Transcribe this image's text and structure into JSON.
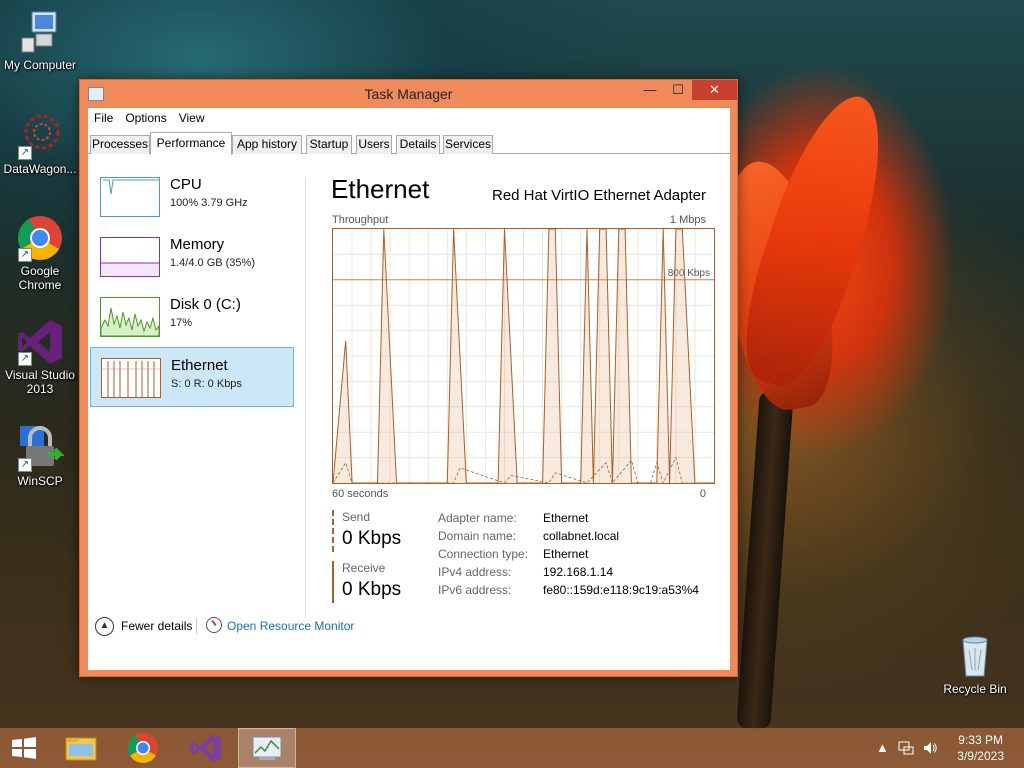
{
  "desktop": {
    "icons": [
      {
        "label": "My Computer",
        "icon": "computer-icon"
      },
      {
        "label": "DataWagon...",
        "icon": "datawagon-icon"
      },
      {
        "label": "Google Chrome",
        "icon": "chrome-icon"
      },
      {
        "label": "Visual Studio 2013",
        "icon": "visual-studio-icon"
      },
      {
        "label": "WinSCP",
        "icon": "winscp-icon"
      },
      {
        "label": "Recycle Bin",
        "icon": "recycle-bin-icon"
      }
    ]
  },
  "window": {
    "title": "Task Manager",
    "controls": {
      "minimize": "—",
      "maximize": "☐",
      "close": "✕"
    },
    "accent_color": "#f08a5a"
  },
  "menu": [
    "File",
    "Options",
    "View"
  ],
  "tabs": [
    "Processes",
    "Performance",
    "App history",
    "Startup",
    "Users",
    "Details",
    "Services"
  ],
  "active_tab": "Performance",
  "nav": [
    {
      "title": "CPU",
      "sub": "100%  3.79 GHz",
      "color": "#4a9ccb"
    },
    {
      "title": "Memory",
      "sub": "1.4/4.0 GB (35%)",
      "color": "#8b2fa8"
    },
    {
      "title": "Disk 0 (C:)",
      "sub": "17%",
      "color": "#4d9a1e"
    },
    {
      "title": "Ethernet",
      "sub": "S: 0 R: 0 Kbps",
      "color": "#a7602a",
      "selected": true
    }
  ],
  "ethernet": {
    "title": "Ethernet",
    "adapter": "Red Hat VirtIO Ethernet Adapter",
    "throughput_label": "Throughput",
    "max_label": "1 Mbps",
    "ref_label": "800 Kbps",
    "xaxis_left": "60 seconds",
    "xaxis_right": "0",
    "send_label": "Send",
    "send_value": "0 Kbps",
    "receive_label": "Receive",
    "receive_value": "0 Kbps",
    "properties": [
      {
        "key": "Adapter name:",
        "value": "Ethernet"
      },
      {
        "key": "Domain name:",
        "value": "collabnet.local"
      },
      {
        "key": "Connection type:",
        "value": "Ethernet"
      },
      {
        "key": "IPv4 address:",
        "value": "192.168.1.14"
      },
      {
        "key": "IPv6 address:",
        "value": "fe80::159d:e118:9c19:a53%4"
      }
    ]
  },
  "footer": {
    "fewer_details": "Fewer details",
    "open_resource_monitor": "Open Resource Monitor"
  },
  "chart_data": {
    "type": "line",
    "title": "Throughput",
    "xlabel": "60 seconds",
    "ylabel": "",
    "ylim": [
      0,
      1000
    ],
    "xlim": [
      60,
      0
    ],
    "series": [
      {
        "name": "Receive",
        "x": [
          60,
          58,
          57,
          55,
          53,
          52,
          50,
          48,
          47,
          45,
          44,
          43,
          42,
          41,
          39,
          38,
          37,
          35,
          34,
          33,
          31,
          30,
          29,
          28,
          27,
          26,
          25,
          24,
          22,
          21,
          20,
          19,
          18,
          17,
          16,
          15,
          14,
          13,
          12,
          11,
          10,
          9,
          8,
          7,
          6,
          5,
          3,
          2,
          1,
          0
        ],
        "values": [
          0,
          560,
          0,
          0,
          0,
          1000,
          0,
          0,
          0,
          0,
          0,
          0,
          0,
          1000,
          0,
          0,
          0,
          0,
          0,
          1000,
          0,
          0,
          0,
          0,
          0,
          1000,
          1000,
          0,
          0,
          0,
          1000,
          0,
          1000,
          1000,
          0,
          1000,
          1000,
          0,
          0,
          0,
          0,
          0,
          1000,
          0,
          1000,
          1000,
          0,
          0,
          0,
          0
        ]
      },
      {
        "name": "Send",
        "x": [
          60,
          58,
          57,
          55,
          53,
          50,
          45,
          41,
          40,
          33,
          32,
          26,
          25,
          20,
          17,
          16,
          13,
          12,
          10,
          9,
          8,
          6,
          5,
          3,
          0
        ],
        "values": [
          0,
          80,
          0,
          0,
          0,
          0,
          0,
          0,
          60,
          0,
          30,
          0,
          40,
          0,
          80,
          0,
          90,
          0,
          0,
          80,
          0,
          100,
          0,
          0,
          0
        ]
      }
    ]
  },
  "taskbar": {
    "buttons": [
      "start-icon",
      "file-explorer-icon",
      "chrome-icon",
      "visual-studio-icon",
      "task-manager-icon"
    ],
    "time": "9:33 PM",
    "date": "3/9/2023"
  }
}
